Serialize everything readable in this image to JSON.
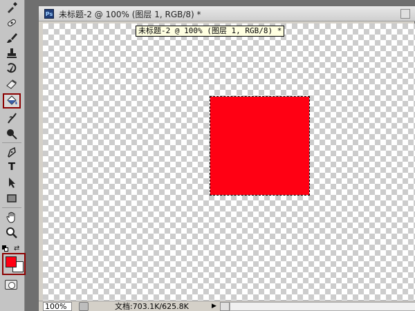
{
  "app": {
    "logo": "Ps"
  },
  "document": {
    "title": "未标题-2 @ 100% (图层 1, RGB/8) *",
    "tooltip": "未标题-2 @ 100% (图层 1, RGB/8) *"
  },
  "canvas": {
    "shape_color": "#ff0013",
    "checker_light": "#ffffff",
    "checker_dark": "#cccccc"
  },
  "statusbar": {
    "zoom": "100%",
    "doc_info": "文档:703.1K/625.8K"
  },
  "colors": {
    "foreground": "#ff0013",
    "background": "#ffffff",
    "highlight_border": "#8b0000"
  },
  "tools": [
    {
      "icon": "eyedropper-icon"
    },
    {
      "icon": "healing-brush-icon"
    },
    {
      "icon": "brush-icon"
    },
    {
      "icon": "clone-stamp-icon"
    },
    {
      "icon": "history-brush-icon"
    },
    {
      "icon": "eraser-icon"
    },
    {
      "icon": "paint-bucket-icon",
      "selected": true
    },
    {
      "icon": "blur-icon"
    },
    {
      "icon": "dodge-icon"
    },
    {
      "icon": "pen-icon"
    },
    {
      "icon": "type-icon",
      "label": "T"
    },
    {
      "icon": "path-selection-icon"
    },
    {
      "icon": "rectangle-icon"
    },
    {
      "icon": "hand-icon"
    },
    {
      "icon": "zoom-icon"
    }
  ]
}
